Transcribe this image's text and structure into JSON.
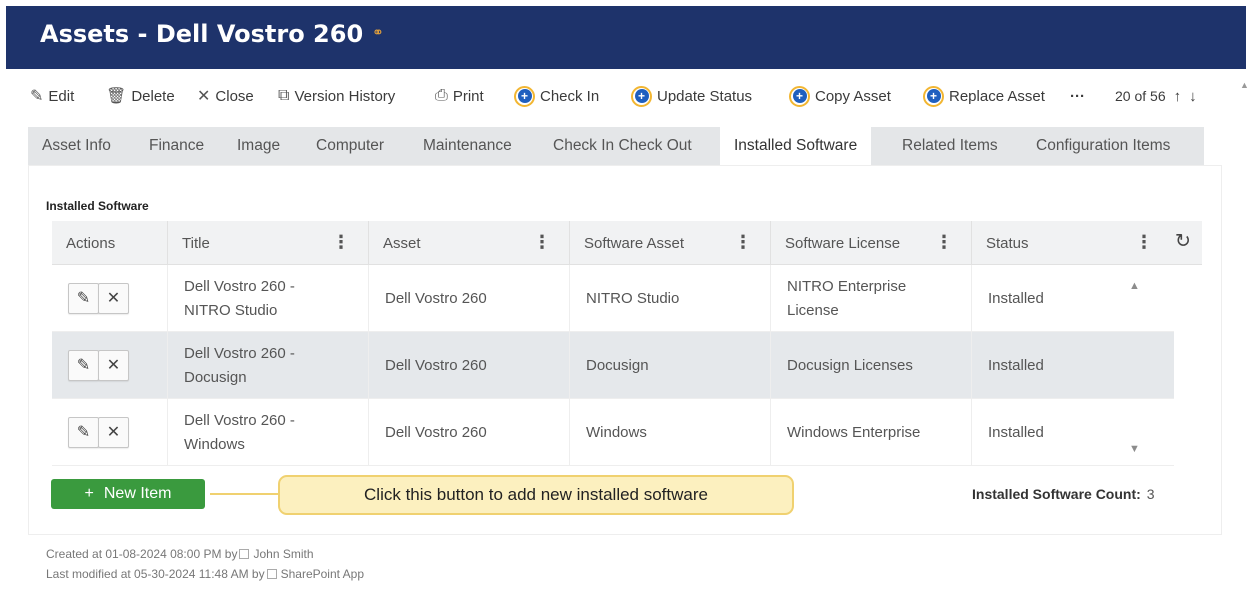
{
  "header": {
    "title": "Assets - Dell Vostro 260",
    "link_icon": "link-icon"
  },
  "toolbar": {
    "edit": "Edit",
    "delete": "Delete",
    "close": "Close",
    "version_history": "Version History",
    "print": "Print",
    "check_in": "Check In",
    "update_status": "Update Status",
    "copy_asset": "Copy Asset",
    "replace_asset": "Replace Asset",
    "more": "···",
    "pager": "20 of 56"
  },
  "tabs": [
    "Asset Info",
    "Finance",
    "Image",
    "Computer",
    "Maintenance",
    "Check In Check Out",
    "Installed Software",
    "Related Items",
    "Configuration Items"
  ],
  "active_tab": "Installed Software",
  "section_label": "Installed Software",
  "grid": {
    "columns": [
      "Actions",
      "Title",
      "Asset",
      "Software Asset",
      "Software License",
      "Status"
    ],
    "rows": [
      {
        "title_1": "Dell Vostro 260 -",
        "title_2": "NITRO Studio",
        "asset": "Dell Vostro 260",
        "software_asset": "NITRO Studio",
        "license_1": "NITRO Enterprise",
        "license_2": "License",
        "status": "Installed"
      },
      {
        "title_1": "Dell Vostro 260 -",
        "title_2": "Docusign",
        "asset": "Dell Vostro 260",
        "software_asset": "Docusign",
        "license_1": "Docusign Licenses",
        "license_2": "",
        "status": "Installed"
      },
      {
        "title_1": "Dell Vostro 260 -",
        "title_2": "Windows",
        "asset": "Dell Vostro 260",
        "software_asset": "Windows",
        "license_1": "Windows Enterprise",
        "license_2": "",
        "status": "Installed"
      }
    ]
  },
  "new_item_label": "New Item",
  "callout": "Click this button to add new installed software",
  "count": {
    "label": "Installed Software Count:",
    "value": "3"
  },
  "meta": {
    "created_prefix": "Created at 01-08-2024 08:00 PM by",
    "created_by": "John Smith",
    "modified_prefix": "Last modified at 05-30-2024 11:48 AM by",
    "modified_by": "SharePoint App"
  },
  "colors": {
    "header_bg": "#1e336b",
    "accent_green": "#3a9a3e",
    "callout_bg": "#fcf0bf",
    "check_in_circle": "#1f5fbf",
    "circle_ring": "#f2b632"
  }
}
